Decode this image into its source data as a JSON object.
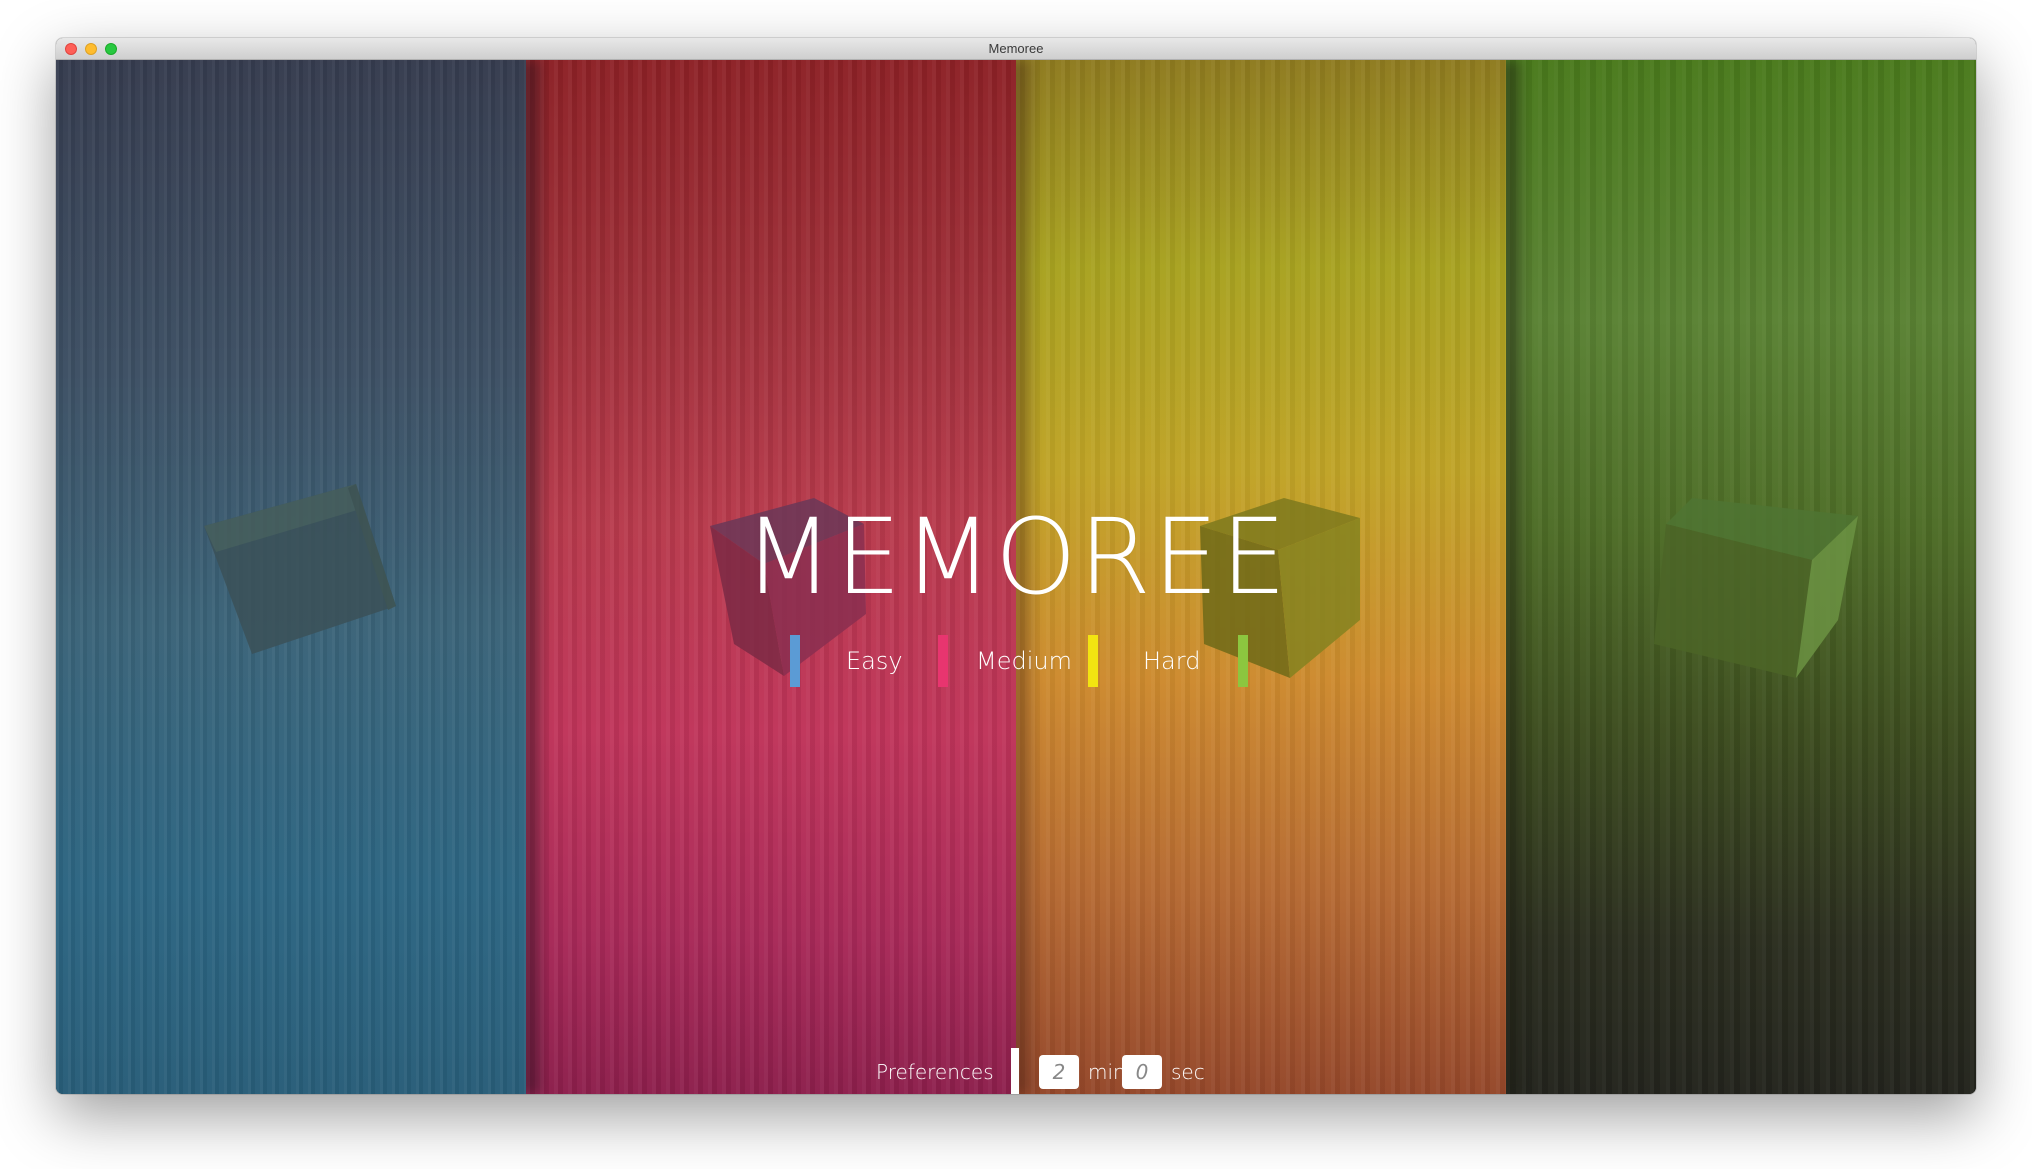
{
  "window": {
    "title": "Memoree"
  },
  "app": {
    "title": "MEMOREE",
    "difficulties": [
      {
        "label": "",
        "color": "#5b9bd5"
      },
      {
        "label": "Easy",
        "color": "#e8356f"
      },
      {
        "label": "Medium",
        "color": "#f2e411"
      },
      {
        "label": "Hard",
        "color": "#8cc63f"
      }
    ],
    "preferences": {
      "label": "Preferences",
      "minutes": "2",
      "minutes_unit": "min",
      "seconds": "0",
      "seconds_unit": "sec"
    }
  },
  "colors": {
    "blue_accent": "#5b9bd5",
    "red_accent": "#e8356f",
    "yellow_accent": "#f2e411",
    "green_accent": "#8cc63f"
  }
}
